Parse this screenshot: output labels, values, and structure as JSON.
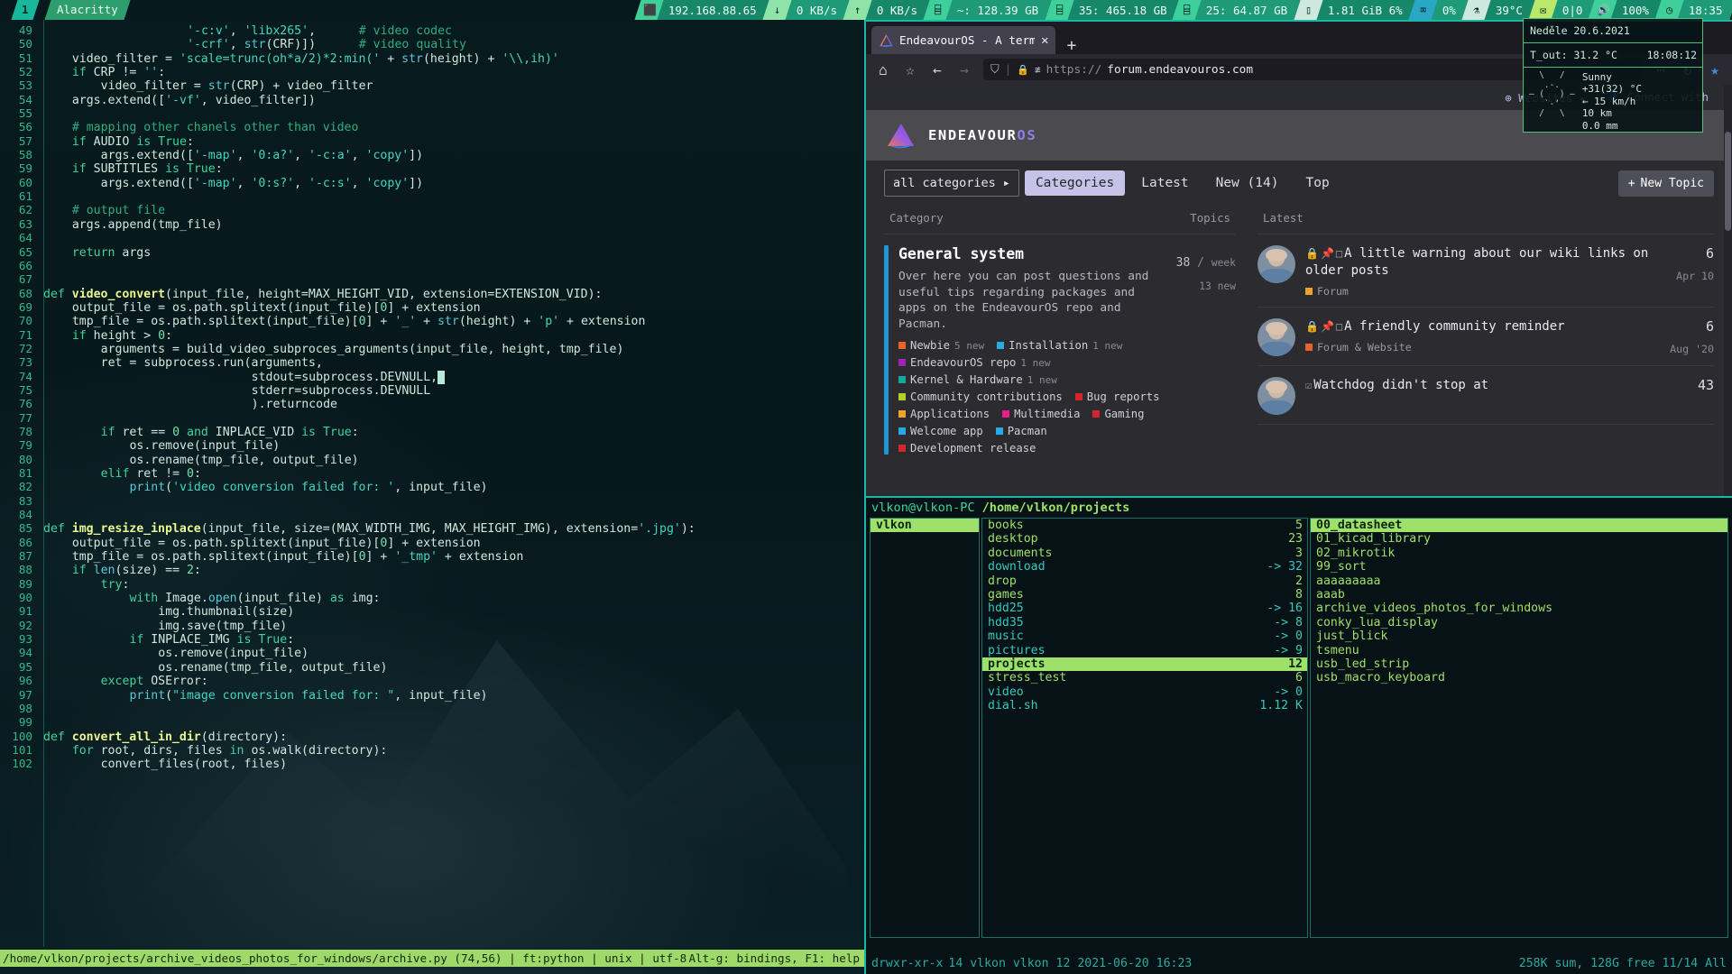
{
  "taskbar": {
    "workspace": "1",
    "window_title": "Alacritty",
    "stats": [
      {
        "icon": "network-icon",
        "glyph": "⬛",
        "value": "192.168.88.65"
      },
      {
        "icon": "download-icon",
        "glyph": "↓",
        "value": "0 KB/s"
      },
      {
        "icon": "upload-icon",
        "glyph": "↑",
        "value": "0 KB/s"
      },
      {
        "icon": "disk-icon",
        "glyph": "⌸",
        "value": "~: 128.39 GB"
      },
      {
        "icon": "disk-icon",
        "glyph": "⌸",
        "value": "35: 465.18 GB"
      },
      {
        "icon": "disk-icon",
        "glyph": "⌸",
        "value": "25: 64.87 GB"
      },
      {
        "icon": "memory-icon",
        "glyph": "▯",
        "value": "1.81 GiB   6%"
      },
      {
        "icon": "cpu-icon",
        "glyph": "⌧",
        "value": "0%"
      },
      {
        "icon": "thermometer-icon",
        "glyph": "⚗",
        "value": "39°C"
      },
      {
        "icon": "mail-icon",
        "glyph": "✉",
        "value": "0|0"
      },
      {
        "icon": "volume-icon",
        "glyph": "🔊",
        "value": "100%"
      },
      {
        "icon": "clock-icon",
        "glyph": "◷",
        "value": "18:35"
      }
    ]
  },
  "conky": {
    "date": "Neděle 20.6.2021",
    "t_out_label": "T_out: 31.2 °C",
    "clock": "18:08:12",
    "sun_art": "  \\   /\n   .-.\n– (   ) –\n   `-’\n  /   \\",
    "weather": [
      "Sunny",
      "+31(32) °C",
      "← 15 km/h",
      "10 km",
      "0.0 mm"
    ]
  },
  "editor": {
    "status_path": "/home/vlkon/projects/archive_videos_photos_for_windows/archive.py (74,56)",
    "status_ft": "ft:python",
    "status_eol": "unix",
    "status_enc": "utf-8",
    "status_help": "Alt-g: bindings, F1: help",
    "first_line": 49,
    "lines": [
      "                    '-c:v', 'libx265',      # video codec",
      "                    '-crf', str(CRF)])      # video quality",
      "    video_filter = 'scale=trunc(oh*a/2)*2:min(' + str(height) + '\\\\,ih)'",
      "    if CRP != '':",
      "        video_filter = str(CRP) + video_filter",
      "    args.extend(['-vf', video_filter])",
      "",
      "    # mapping other chanels other than video",
      "    if AUDIO is True:",
      "        args.extend(['-map', '0:a?', '-c:a', 'copy'])",
      "    if SUBTITLES is True:",
      "        args.extend(['-map', '0:s?', '-c:s', 'copy'])",
      "",
      "    # output file",
      "    args.append(tmp_file)",
      "",
      "    return args",
      "",
      "",
      "def video_convert(input_file, height=MAX_HEIGHT_VID, extension=EXTENSION_VID):",
      "    output_file = os.path.splitext(input_file)[0] + extension",
      "    tmp_file = os.path.splitext(input_file)[0] + '_' + str(height) + 'p' + extension",
      "    if height > 0:",
      "        arguments = build_video_subproces_arguments(input_file, height, tmp_file)",
      "        ret = subprocess.run(arguments,",
      "                             stdout=subprocess.DEVNULL,",
      "                             stderr=subprocess.DEVNULL",
      "                             ).returncode",
      "",
      "        if ret == 0 and INPLACE_VID is True:",
      "            os.remove(input_file)",
      "            os.rename(tmp_file, output_file)",
      "        elif ret != 0:",
      "            print('video conversion failed for: ', input_file)",
      "",
      "",
      "def img_resize_inplace(input_file, size=(MAX_WIDTH_IMG, MAX_HEIGHT_IMG), extension='.jpg'):",
      "    output_file = os.path.splitext(input_file)[0] + extension",
      "    tmp_file = os.path.splitext(input_file)[0] + '_tmp' + extension",
      "    if len(size) == 2:",
      "        try:",
      "            with Image.open(input_file) as img:",
      "                img.thumbnail(size)",
      "                img.save(tmp_file)",
      "            if INPLACE_IMG is True:",
      "                os.remove(input_file)",
      "                os.rename(tmp_file, output_file)",
      "        except OSError:",
      "            print(\"image conversion failed for: \", input_file)",
      "",
      "",
      "def convert_all_in_dir(directory):",
      "    for root, dirs, files in os.walk(directory):",
      "        convert_files(root, files)"
    ]
  },
  "firefox": {
    "tab_title": "EndeavourOS - A terminal-",
    "tab_close_glyph": "✕",
    "new_tab_glyph": "+",
    "url_protocol": "https://",
    "url_host": "forum.endeavouros.com",
    "menu_glyph": "⋯",
    "reload_glyph": "↻",
    "star_glyph": "★",
    "home_glyph": "⌂",
    "pocket_glyph": "☆",
    "back_glyph": "←",
    "forward_glyph": "→",
    "shield_glyph": "⛉",
    "lock_glyph": "🔒",
    "perms_glyph": "❂"
  },
  "forum": {
    "top_links": [
      {
        "icon": "globe-icon",
        "glyph": "⊕",
        "label": "Websites",
        "caret": "▸"
      },
      {
        "icon": "user-icon",
        "glyph": "●",
        "label": "Connect with",
        "caret": ""
      }
    ],
    "brand": {
      "word_main": "ENDEAVOUR",
      "word_accent": "OS"
    },
    "nav": {
      "dropdown": "all categories",
      "dropdown_caret": "▸",
      "tabs": [
        {
          "label": "Categories",
          "active": true
        },
        {
          "label": "Latest",
          "active": false
        },
        {
          "label": "New (14)",
          "active": false
        },
        {
          "label": "Top",
          "active": false
        }
      ],
      "new_topic": "New Topic",
      "new_topic_plus": "+"
    },
    "col_left_head": {
      "category": "Category",
      "topics": "Topics"
    },
    "col_right_head": {
      "latest": "Latest"
    },
    "category": {
      "title": "General system",
      "description": "Over here you can post questions and useful tips regarding packages and apps on the EndeavourOS repo and Pacman.",
      "count": "38",
      "slash": "/",
      "period": "week",
      "new": "13 new",
      "accent_color": "#2196d6",
      "subcategories": [
        {
          "label": "Newbie",
          "new": "5 new",
          "color": "#e8622c"
        },
        {
          "label": "Installation",
          "new": "1 new",
          "color": "#29aae2"
        },
        {
          "label": "EndeavourOS repo",
          "new": "1 new",
          "color": "#9b27b0"
        },
        {
          "label": "Kernel & Hardware",
          "new": "1 new",
          "color": "#12a89c"
        },
        {
          "label": "Community contributions",
          "new": "",
          "color": "#b5cc2f"
        },
        {
          "label": "Bug reports",
          "new": "",
          "color": "#d3262c"
        },
        {
          "label": "Applications",
          "new": "",
          "color": "#f0a32b"
        },
        {
          "label": "Multimedia",
          "new": "",
          "color": "#e91e8c"
        },
        {
          "label": "Gaming",
          "new": "",
          "color": "#d3262c"
        },
        {
          "label": "Welcome app",
          "new": "",
          "color": "#29aae2"
        },
        {
          "label": "Pacman",
          "new": "",
          "color": "#29aae2"
        },
        {
          "label": "Development release",
          "new": "",
          "color": "#d3262c"
        }
      ]
    },
    "topics": [
      {
        "lock": "🔒",
        "pin": "📌",
        "box": "□",
        "title": "A little warning about our wiki links on older posts",
        "category": "Forum",
        "cat_color": "#f0a32b",
        "cat_color2": "#9b27b0",
        "count": "6",
        "date": "Apr 10"
      },
      {
        "lock": "🔒",
        "pin": "📌",
        "box": "□",
        "title": "A friendly community reminder",
        "category": "Forum & Website",
        "cat_color": "#e8622c",
        "cat_color2": "#e8622c",
        "count": "6",
        "date": "Aug '20"
      },
      {
        "lock": "",
        "pin": "",
        "box": "☑",
        "title": "Watchdog didn't stop at",
        "category": "",
        "cat_color": "#9b27b0",
        "cat_color2": "#9b27b0",
        "count": "43",
        "date": ""
      }
    ]
  },
  "ranger": {
    "user_host": "vlkon@vlkon-PC",
    "path": "/home/vlkon/projects",
    "col1": [
      {
        "name": "vlkon",
        "size": "",
        "type": "dir",
        "selected": true
      }
    ],
    "col2": [
      {
        "name": "books",
        "size": "5",
        "type": "dir",
        "selected": false
      },
      {
        "name": "desktop",
        "size": "23",
        "type": "dir",
        "selected": false
      },
      {
        "name": "documents",
        "size": "3",
        "type": "dir",
        "selected": false
      },
      {
        "name": "download",
        "size": "-> 32",
        "type": "link",
        "selected": false
      },
      {
        "name": "drop",
        "size": "2",
        "type": "dir",
        "selected": false
      },
      {
        "name": "games",
        "size": "8",
        "type": "dir",
        "selected": false
      },
      {
        "name": "hdd25",
        "size": "-> 16",
        "type": "link",
        "selected": false
      },
      {
        "name": "hdd35",
        "size": "-> 8",
        "type": "link",
        "selected": false
      },
      {
        "name": "music",
        "size": "-> 0",
        "type": "link",
        "selected": false
      },
      {
        "name": "pictures",
        "size": "-> 9",
        "type": "link",
        "selected": false
      },
      {
        "name": "projects",
        "size": "12",
        "type": "dir",
        "selected": true
      },
      {
        "name": "stress_test",
        "size": "6",
        "type": "dir",
        "selected": false
      },
      {
        "name": "video",
        "size": "-> 0",
        "type": "link",
        "selected": false
      },
      {
        "name": "dial.sh",
        "size": "1.12 K",
        "type": "link",
        "selected": false
      }
    ],
    "col3": [
      {
        "name": "00_datasheet",
        "size": "",
        "type": "dir",
        "selected": true
      },
      {
        "name": "01_kicad_library",
        "size": "",
        "type": "dir",
        "selected": false
      },
      {
        "name": "02_mikrotik",
        "size": "",
        "type": "dir",
        "selected": false
      },
      {
        "name": "99_sort",
        "size": "",
        "type": "dir",
        "selected": false
      },
      {
        "name": "aaaaaaaaa",
        "size": "",
        "type": "dir",
        "selected": false
      },
      {
        "name": "aaab",
        "size": "",
        "type": "dir",
        "selected": false
      },
      {
        "name": "archive_videos_photos_for_windows",
        "size": "",
        "type": "dir",
        "selected": false
      },
      {
        "name": "conky_lua_display",
        "size": "",
        "type": "dir",
        "selected": false
      },
      {
        "name": "just_blick",
        "size": "",
        "type": "dir",
        "selected": false
      },
      {
        "name": "tsmenu",
        "size": "",
        "type": "dir",
        "selected": false
      },
      {
        "name": "usb_led_strip",
        "size": "",
        "type": "dir",
        "selected": false
      },
      {
        "name": "usb_macro_keyboard",
        "size": "",
        "type": "dir",
        "selected": false
      }
    ],
    "status_perm": "drwxr-xr-x",
    "status_mid": "14 vlkon vlkon 12 2021-06-20 16:23",
    "status_right": "258K sum, 128G free  11/14  All"
  }
}
